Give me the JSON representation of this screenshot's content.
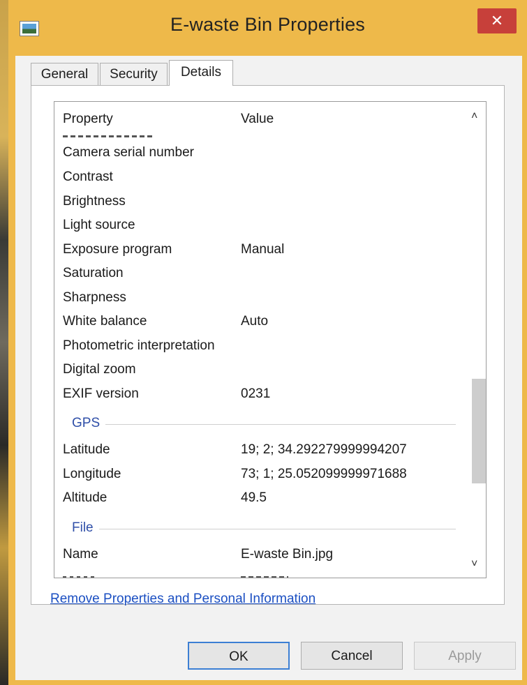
{
  "window": {
    "title": "E-waste Bin Properties",
    "close_glyph": "✕"
  },
  "tabs": [
    {
      "label": "General"
    },
    {
      "label": "Security"
    },
    {
      "label": "Details"
    }
  ],
  "details": {
    "columns": {
      "property": "Property",
      "value": "Value"
    },
    "camera_rows": [
      {
        "property": "Camera serial number",
        "value": ""
      },
      {
        "property": "Contrast",
        "value": ""
      },
      {
        "property": "Brightness",
        "value": ""
      },
      {
        "property": "Light source",
        "value": ""
      },
      {
        "property": "Exposure program",
        "value": "Manual"
      },
      {
        "property": "Saturation",
        "value": ""
      },
      {
        "property": "Sharpness",
        "value": ""
      },
      {
        "property": "White balance",
        "value": "Auto"
      },
      {
        "property": "Photometric interpretation",
        "value": ""
      },
      {
        "property": "Digital zoom",
        "value": ""
      },
      {
        "property": "EXIF version",
        "value": "0231"
      }
    ],
    "gps_group": "GPS",
    "gps_rows": [
      {
        "property": "Latitude",
        "value": "19; 2; 34.292279999994207"
      },
      {
        "property": "Longitude",
        "value": "73; 1; 25.052099999971688"
      },
      {
        "property": "Altitude",
        "value": "49.5"
      }
    ],
    "file_group": "File",
    "file_rows": [
      {
        "property": "Name",
        "value": "E-waste Bin.jpg"
      }
    ],
    "scroll_up_glyph": "˄",
    "scroll_down_glyph": "˅"
  },
  "remove_link": "Remove Properties and Personal Information",
  "buttons": {
    "ok": "OK",
    "cancel": "Cancel",
    "apply": "Apply"
  },
  "colors": {
    "frame": "#eeb94a",
    "close": "#c7403a",
    "link": "#1b4fc2",
    "group": "#2f4fa8"
  }
}
